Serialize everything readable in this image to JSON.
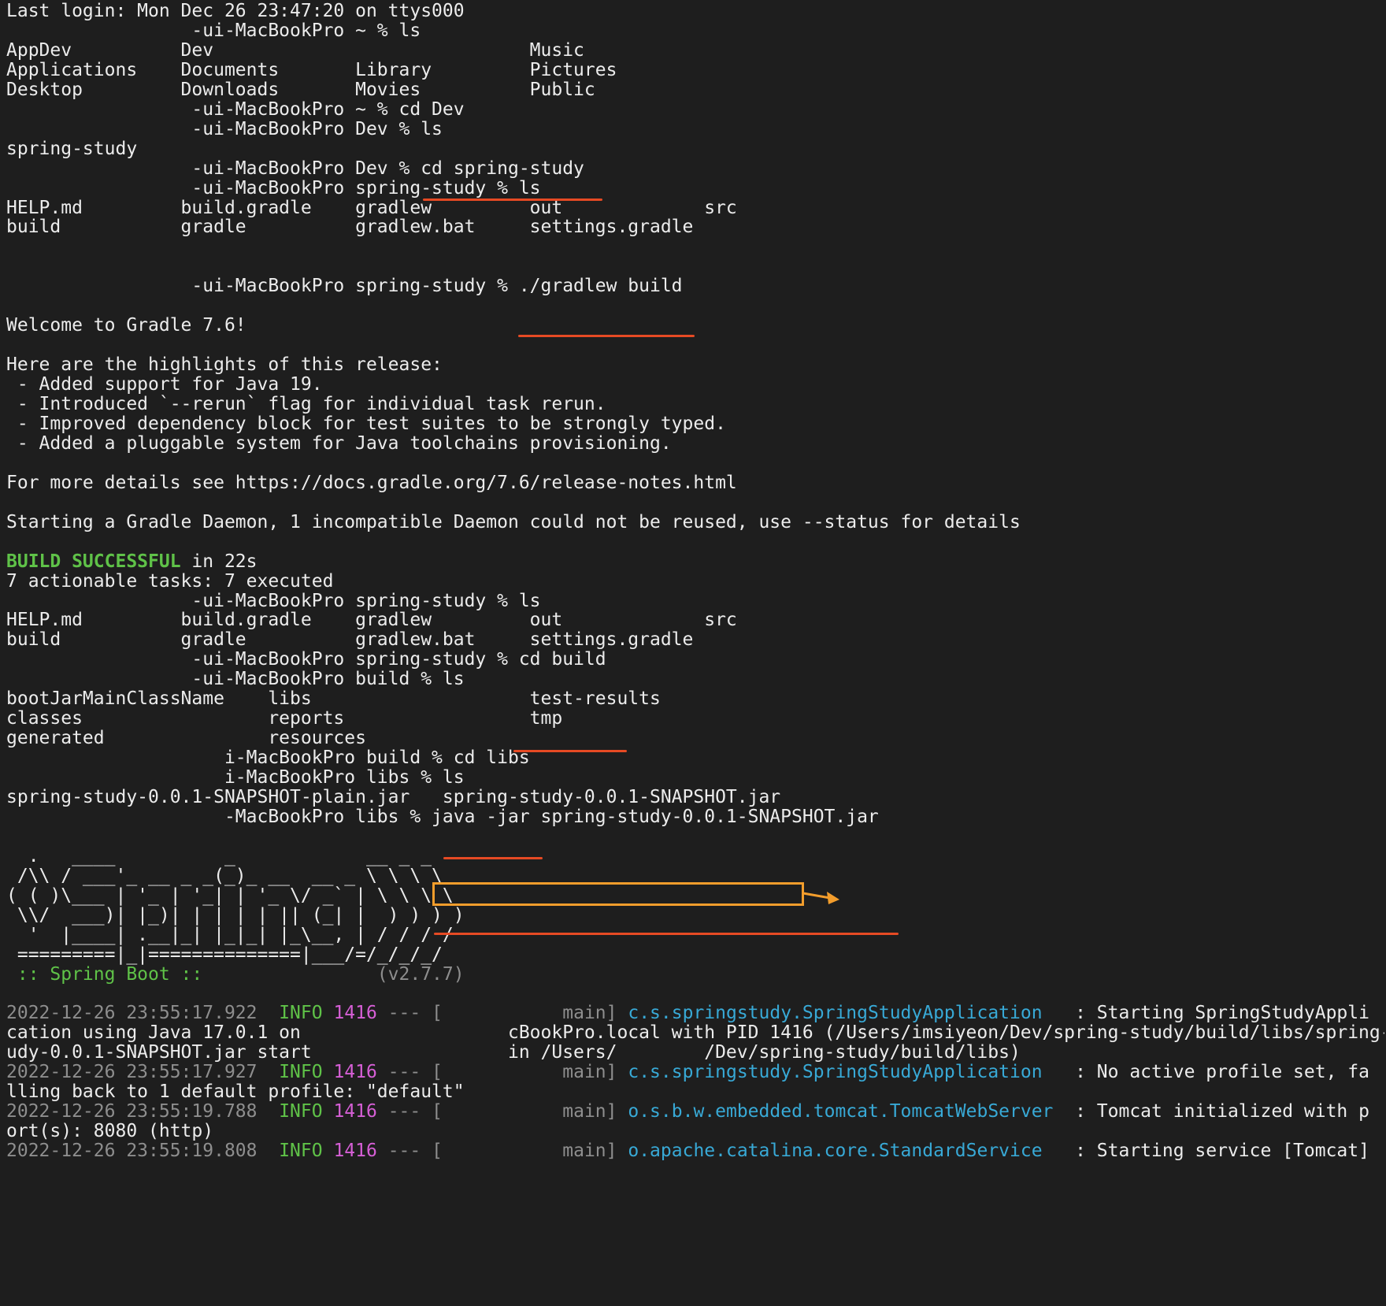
{
  "app": {
    "name": "Terminal",
    "session": "ttys000"
  },
  "lines": [
    "Last login: Mon Dec 26 23:47:20 on ttys000",
    "                 -ui-MacBookPro ~ % ls",
    "AppDev          Dev                             Music",
    "Applications    Documents       Library         Pictures",
    "Desktop         Downloads       Movies          Public",
    "                 -ui-MacBookPro ~ % cd Dev",
    "                 -ui-MacBookPro Dev % ls",
    "spring-study",
    "                 -ui-MacBookPro Dev % cd spring-study",
    "                 -ui-MacBookPro spring-study % ls",
    "HELP.md         build.gradle    gradlew         out             src",
    "build           gradle          gradlew.bat     settings.gradle",
    "",
    "",
    "                 -ui-MacBookPro spring-study % ./gradlew build",
    "",
    "Welcome to Gradle 7.6!",
    "",
    "Here are the highlights of this release:",
    " - Added support for Java 19.",
    " - Introduced `--rerun` flag for individual task rerun.",
    " - Improved dependency block for test suites to be strongly typed.",
    " - Added a pluggable system for Java toolchains provisioning.",
    "",
    "For more details see https://docs.gradle.org/7.6/release-notes.html",
    "",
    "Starting a Gradle Daemon, 1 incompatible Daemon could not be reused, use --status for details",
    "",
    "",
    "7 actionable tasks: 7 executed",
    "                 -ui-MacBookPro spring-study % ls",
    "HELP.md         build.gradle    gradlew         out             src",
    "build           gradle          gradlew.bat     settings.gradle",
    "                 -ui-MacBookPro spring-study % cd build",
    "                 -ui-MacBookPro build % ls",
    "bootJarMainClassName    libs                    test-results",
    "classes                 reports                 tmp",
    "generated               resources",
    "                    i-MacBookPro build % cd libs",
    "                    i-MacBookPro libs % ls",
    "spring-study-0.0.1-SNAPSHOT-plain.jar   spring-study-0.0.1-SNAPSHOT.jar",
    "                    -MacBookPro libs % java -jar spring-study-0.0.1-SNAPSHOT.jar",
    "",
    "  .   ____          _            __ _ _",
    " /\\\\ / ___'_ __ _ _(_)_ __  __ _ \\ \\ \\ \\",
    "( ( )\\___ | '_ | '_| | '_ \\/ _` | \\ \\ \\ \\",
    " \\\\/  ___)| |_)| | | | | || (_| |  ) ) ) )",
    "  '  |____| .__|_| |_|_| |_\\__, | / / / /",
    " =========|_|==============|___/=/_/_/_/",
    "",
    "",
    "",
    "cation using Java 17.0.1 on                   cBookPro.local with PID 1416 (/Users/imsiyeon/Dev/spring-study/build/libs/spring-st",
    "udy-0.0.1-SNAPSHOT.jar start                  in /Users/        /Dev/spring-study/build/libs)",
    "",
    "lling back to 1 default profile: \"default\"",
    "",
    "ort(s): 8080 (http)",
    ""
  ],
  "build_result": {
    "status": "BUILD SUCCESSFUL",
    "rest": " in 22s"
  },
  "spring_banner": {
    "label": " :: Spring Boot :: ",
    "version": "               (v2.7.7)"
  },
  "log_entries": [
    {
      "timestamp": "2022-12-26 23:55:17.922",
      "level": "INFO",
      "pid": "1416",
      "sep": " --- [",
      "thread": "           main]",
      "logger": "c.s.springstudy.SpringStudyApplication",
      "message": "   : Starting SpringStudyAppli"
    },
    {
      "timestamp": "2022-12-26 23:55:17.927",
      "level": "INFO",
      "pid": "1416",
      "sep": " --- [",
      "thread": "           main]",
      "logger": "c.s.springstudy.SpringStudyApplication",
      "message": "   : No active profile set, fa"
    },
    {
      "timestamp": "2022-12-26 23:55:19.788",
      "level": "INFO",
      "pid": "1416",
      "sep": " --- [",
      "thread": "           main]",
      "logger": "o.s.b.w.embedded.tomcat.TomcatWebServer",
      "message": "  : Tomcat initialized with p"
    },
    {
      "timestamp": "2022-12-26 23:55:19.808",
      "level": "INFO",
      "pid": "1416",
      "sep": " --- [",
      "thread": "           main]",
      "logger": "o.apache.catalina.core.StandardService",
      "message": "   : Starting service [Tomcat]"
    }
  ],
  "colors": {
    "background": "#1e1e1e",
    "text": "#ececec",
    "success": "#5fc248",
    "underline": "#e64a24",
    "highlight_box": "#f29d2c",
    "pid": "#d65fd6",
    "logger": "#38a9d6",
    "dim": "#8e8e8e"
  }
}
